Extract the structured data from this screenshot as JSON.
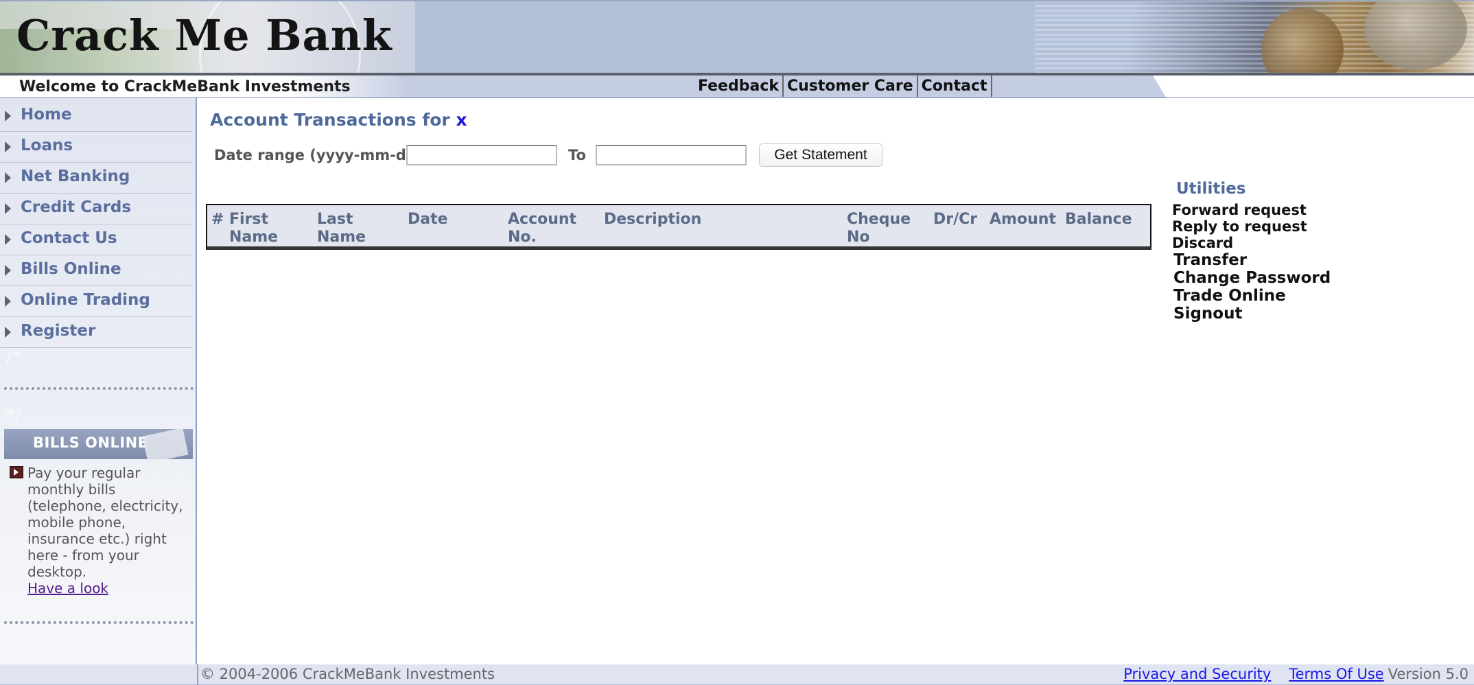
{
  "banner": {
    "logo_text": "Crack Me Bank"
  },
  "navbar": {
    "welcome": "Welcome to CrackMeBank Investments",
    "links": [
      "Feedback",
      "Customer Care",
      "Contact"
    ]
  },
  "sidebar": {
    "items": [
      {
        "label": "Home"
      },
      {
        "label": "Loans"
      },
      {
        "label": "Net Banking"
      },
      {
        "label": "Credit Cards"
      },
      {
        "label": "Contact Us"
      },
      {
        "label": "Bills Online"
      },
      {
        "label": "Online Trading"
      },
      {
        "label": "Register"
      }
    ],
    "comment_open": "/*",
    "comment_close": "*/",
    "promo": {
      "banner": "BILLS ONLINE",
      "text": "Pay your regular monthly bills (telephone, electricity, mobile phone, insurance etc.) right here - from your desktop.",
      "link": "Have a look"
    }
  },
  "main": {
    "title": "Account Transactions for",
    "user": "x",
    "date_label": "Date range (yyyy-mm-dd)",
    "from_value": "",
    "to_label": "To",
    "to_value": "",
    "button": "Get Statement",
    "table": {
      "columns": [
        "#",
        "First Name",
        "Last Name",
        "Date",
        "Account No.",
        "Description",
        "Cheque No",
        "Dr/Cr",
        "Amount",
        "Balance"
      ],
      "rows": []
    }
  },
  "utilities": {
    "title": "Utilities",
    "items": [
      "Forward request",
      "Reply to request",
      "Discard",
      "Transfer",
      "Change Password",
      "Trade Online",
      "Signout"
    ]
  },
  "footer": {
    "copyright": "© 2004-2006 CrackMeBank Investments",
    "privacy": "Privacy and Security",
    "terms": "Terms Of Use",
    "version": "Version 5.0"
  },
  "colors": {
    "nav_link": "#5a6f9e",
    "heading": "#4e6a9a",
    "banner_bg": "#b2c0da",
    "footer_bg": "#dfe3f2"
  }
}
